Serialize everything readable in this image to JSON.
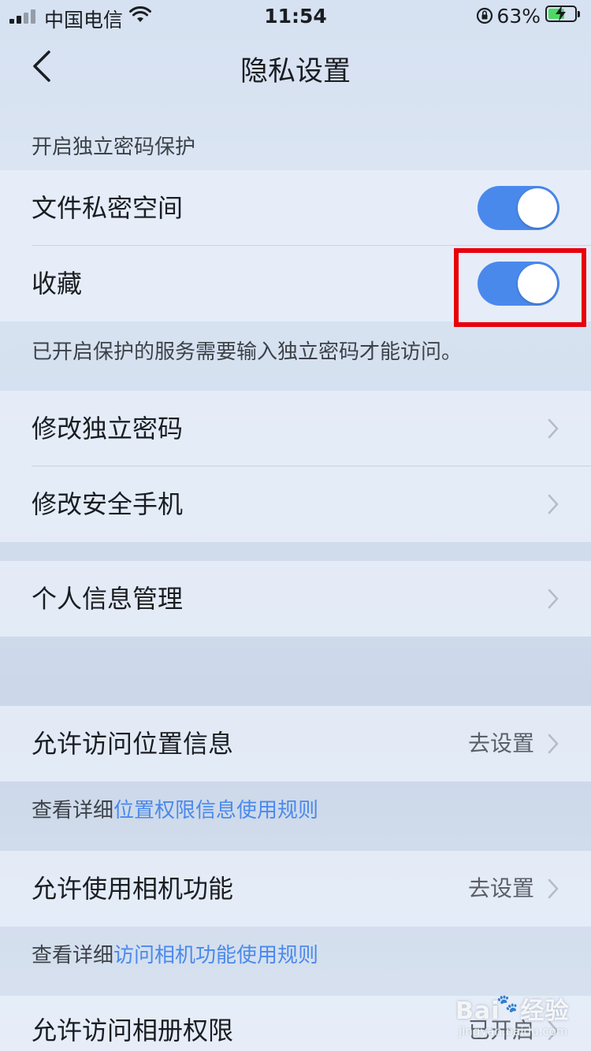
{
  "status_bar": {
    "carrier": "中国电信",
    "time": "11:54",
    "battery_percent": "63%",
    "battery_level": 0.63,
    "icons": [
      "signal-icon",
      "wifi-icon",
      "orientation-lock-icon",
      "battery-charging-icon"
    ]
  },
  "nav": {
    "title": "隐私设置",
    "back_icon": "chevron-left-icon"
  },
  "password_section": {
    "header": "开启独立密码保护",
    "items": [
      {
        "label": "文件私密空间",
        "toggle_on": true
      },
      {
        "label": "收藏",
        "toggle_on": true
      }
    ],
    "note": "已开启保护的服务需要输入独立密码才能访问。"
  },
  "password_actions": {
    "items": [
      {
        "label": "修改独立密码"
      },
      {
        "label": "修改安全手机"
      }
    ]
  },
  "personal": {
    "items": [
      {
        "label": "个人信息管理"
      }
    ]
  },
  "permissions": {
    "location": {
      "label": "允许访问位置信息",
      "value": "去设置",
      "note_prefix": "查看详细",
      "note_link": "位置权限信息使用规则"
    },
    "camera": {
      "label": "允许使用相机功能",
      "value": "去设置",
      "note_prefix": "查看详细",
      "note_link": "访问相机功能使用规则"
    },
    "album": {
      "label": "允许访问相册权限",
      "value": "已开启"
    }
  },
  "watermark": {
    "brand": "Bai",
    "brand_suffix": "经验",
    "url": "jingyan.baidu.com"
  },
  "colors": {
    "accent": "#4a89ec",
    "highlight": "#e8000b",
    "toggle_on": "#4a89ec"
  }
}
